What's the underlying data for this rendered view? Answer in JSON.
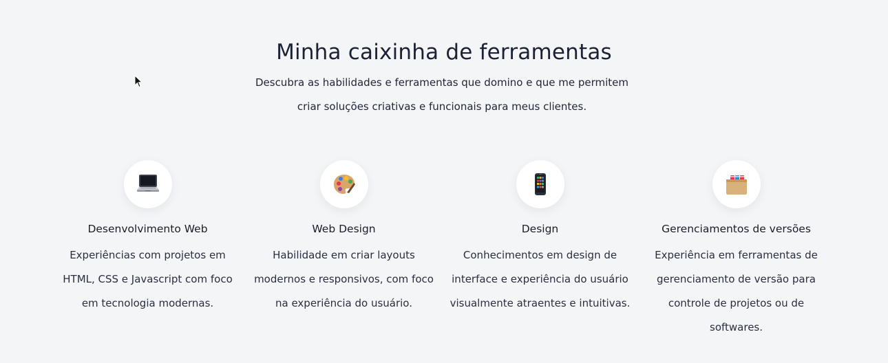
{
  "header": {
    "title": "Minha caixinha de ferramentas",
    "subtitle": "Descubra as habilidades e ferramentas que domino e que me permitem criar soluções criativas e funcionais para meus clientes."
  },
  "cards": [
    {
      "icon": "laptop-icon",
      "title": "Desenvolvimento Web",
      "description": "Experiências com projetos em HTML, CSS e Javascript com foco em tecnologia modernas."
    },
    {
      "icon": "palette-icon",
      "title": "Web Design",
      "description": "Habilidade em criar layouts modernos e responsivos, com foco na experiência do usuário."
    },
    {
      "icon": "mobile-phone-icon",
      "title": "Design",
      "description": "Conhecimentos em design de interface e experiência do usuário visualmente atraentes e intuitivas."
    },
    {
      "icon": "card-file-box-icon",
      "title": "Gerenciamentos de versões",
      "description": "Experiência em ferramentas de gerenciamento de versão para controle de projetos ou de softwares."
    }
  ],
  "colors": {
    "background": "#f4f5f7",
    "heading": "#1c2236",
    "text": "#2a2e3f",
    "circle": "#ffffff"
  }
}
